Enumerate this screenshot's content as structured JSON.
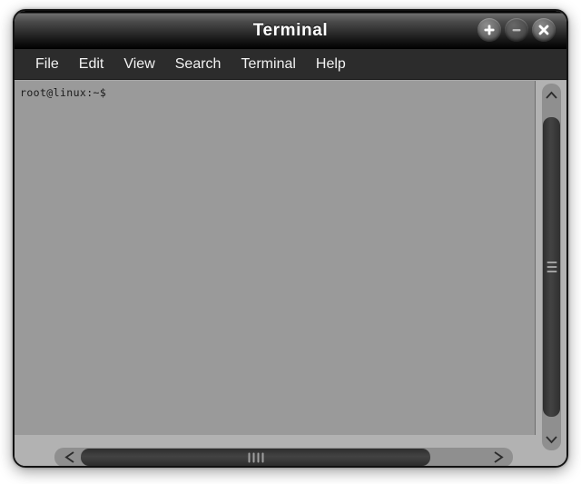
{
  "window": {
    "title": "Terminal",
    "frame_color": "#a8a8a8",
    "titlebar_color": "#000000"
  },
  "titlebar_buttons": [
    {
      "name": "maximize",
      "glyph": "+",
      "label": "Maximize",
      "color": "#5d5d5d"
    },
    {
      "name": "minimize",
      "glyph": "−",
      "label": "Minimize",
      "color": "#474747"
    },
    {
      "name": "close",
      "glyph": "✕",
      "label": "Close",
      "color": "#5a5a5a"
    }
  ],
  "menubar": {
    "items": [
      {
        "label": "File"
      },
      {
        "label": "Edit"
      },
      {
        "label": "View"
      },
      {
        "label": "Search"
      },
      {
        "label": "Terminal"
      },
      {
        "label": "Help"
      }
    ],
    "background": "#2c2c2c",
    "text_color": "#f2f2f2"
  },
  "terminal": {
    "background": "#9a9a9a",
    "text_color": "#1b1b1b",
    "lines": [
      "root@linux:~$"
    ],
    "prompt": "root@linux:~$"
  },
  "scrollbars": {
    "vertical": {
      "up_arrow_icon": "chevron-up-icon",
      "down_arrow_icon": "chevron-down-icon",
      "thumb_color": "#3a3a3a",
      "track_color": "#8f8f8f",
      "grip_lines": 3
    },
    "horizontal": {
      "left_arrow_icon": "chevron-left-icon",
      "right_arrow_icon": "chevron-right-icon",
      "thumb_color": "#3a3a3a",
      "track_color": "#8f8f8f",
      "grip_lines": 4
    }
  }
}
